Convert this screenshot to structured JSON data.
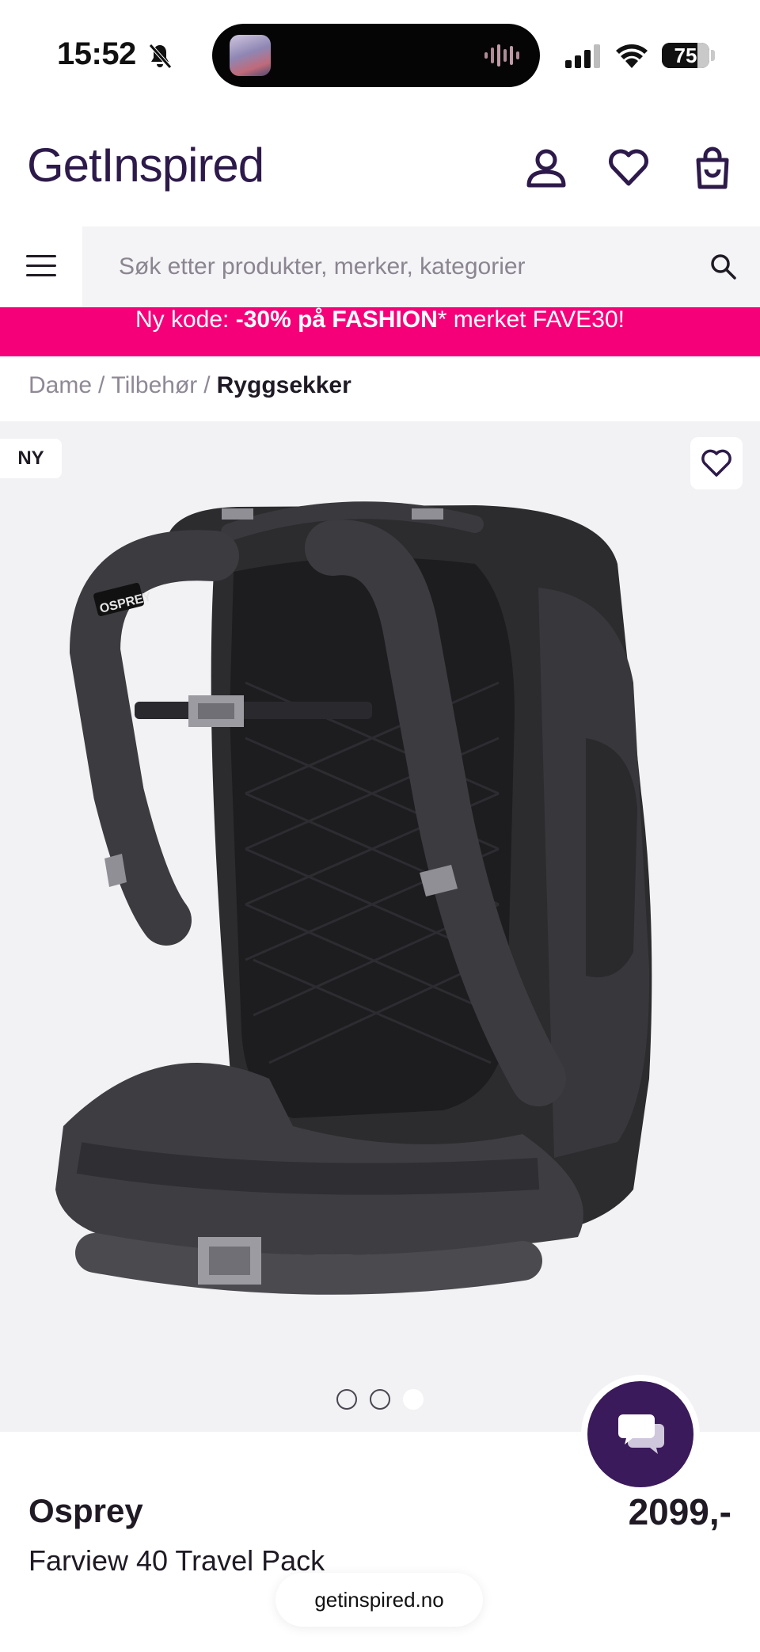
{
  "status_bar": {
    "time": "15:52",
    "battery_level": "75",
    "icons": [
      "bell-off-icon",
      "signal-icon",
      "wifi-icon",
      "battery-icon",
      "audio-wave-icon"
    ]
  },
  "header": {
    "logo": "GetInspired",
    "icons": [
      "account-icon",
      "heart-icon",
      "shopping-bag-icon"
    ]
  },
  "search": {
    "placeholder": "Søk etter produkter, merker, kategorier",
    "value": ""
  },
  "promo": {
    "prefix": "Ny kode: ",
    "highlight": "-30% på FASHION",
    "suffix": "* merket FAVE30!",
    "color": "#f6007a"
  },
  "breadcrumb": {
    "items": [
      "Dame",
      "Tilbehør"
    ],
    "separator": "/",
    "current": "Ryggsekker"
  },
  "gallery": {
    "badge": "NY",
    "image_count": 3,
    "active_image": 3
  },
  "product": {
    "brand": "Osprey",
    "name": "Farview 40 Travel Pack",
    "price": "2099,-",
    "image_brand_label": "OSPREY"
  },
  "browser": {
    "url": "getinspired.no"
  },
  "colors": {
    "brand_purple": "#2d1a4a",
    "chat_purple": "#3a1a5a",
    "promo_pink": "#f6007a"
  }
}
